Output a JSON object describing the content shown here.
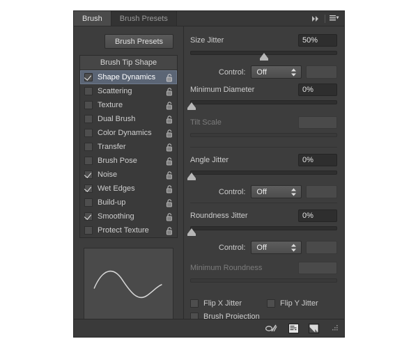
{
  "panel": {
    "tabs": [
      {
        "label": "Brush",
        "active": true
      },
      {
        "label": "Brush Presets",
        "active": false
      }
    ],
    "collapse_icon": "double-chevron-right-icon",
    "menu_icon": "panel-menu-icon"
  },
  "left": {
    "presets_button": "Brush Presets",
    "list_header": "Brush Tip Shape",
    "options": [
      {
        "label": "Shape Dynamics",
        "checked": true,
        "selected": true,
        "lock": "unlocked"
      },
      {
        "label": "Scattering",
        "checked": false,
        "selected": false,
        "lock": "unlocked"
      },
      {
        "label": "Texture",
        "checked": false,
        "selected": false,
        "lock": "unlocked"
      },
      {
        "label": "Dual Brush",
        "checked": false,
        "selected": false,
        "lock": "unlocked"
      },
      {
        "label": "Color Dynamics",
        "checked": false,
        "selected": false,
        "lock": "unlocked"
      },
      {
        "label": "Transfer",
        "checked": false,
        "selected": false,
        "lock": "unlocked"
      },
      {
        "label": "Brush Pose",
        "checked": false,
        "selected": false,
        "lock": "unlocked"
      },
      {
        "label": "Noise",
        "checked": true,
        "selected": false,
        "lock": "unlocked"
      },
      {
        "label": "Wet Edges",
        "checked": true,
        "selected": false,
        "lock": "unlocked"
      },
      {
        "label": "Build-up",
        "checked": false,
        "selected": false,
        "lock": "unlocked"
      },
      {
        "label": "Smoothing",
        "checked": true,
        "selected": false,
        "lock": "unlocked"
      },
      {
        "label": "Protect Texture",
        "checked": false,
        "selected": false,
        "lock": "unlocked"
      }
    ],
    "preview_name": "brush-stroke-preview"
  },
  "right": {
    "size_jitter": {
      "label": "Size Jitter",
      "value": "50%",
      "slider_pct": 50,
      "control_label": "Control:",
      "control_value": "Off"
    },
    "minimum_diameter": {
      "label": "Minimum Diameter",
      "value": "0%",
      "slider_pct": 0
    },
    "tilt_scale": {
      "label": "Tilt Scale",
      "value": "",
      "slider_pct": 0,
      "disabled": true
    },
    "angle_jitter": {
      "label": "Angle Jitter",
      "value": "0%",
      "slider_pct": 0,
      "control_label": "Control:",
      "control_value": "Off"
    },
    "roundness_jitter": {
      "label": "Roundness Jitter",
      "value": "0%",
      "slider_pct": 0,
      "control_label": "Control:",
      "control_value": "Off"
    },
    "minimum_roundness": {
      "label": "Minimum Roundness",
      "value": "",
      "slider_pct": 0,
      "disabled": true
    },
    "checkboxes": [
      {
        "label": "Flip X Jitter",
        "checked": false
      },
      {
        "label": "Flip Y Jitter",
        "checked": false
      },
      {
        "label": "Brush Projection",
        "checked": false
      }
    ]
  },
  "footer": {
    "icons": [
      {
        "name": "toggle-live-tip-brush-preview-icon"
      },
      {
        "name": "new-brush-preset-from-settings-icon"
      },
      {
        "name": "create-new-brush-icon"
      }
    ],
    "resize_grip": "resize-grip-icon"
  },
  "colors": {
    "panel_bg": "#3d3d3d",
    "list_bg": "#3a3a3a",
    "selection": "#5b6575",
    "text": "#cdcdcd",
    "text_dim": "#7c7c7c",
    "field_bg": "#2e2e2e"
  }
}
